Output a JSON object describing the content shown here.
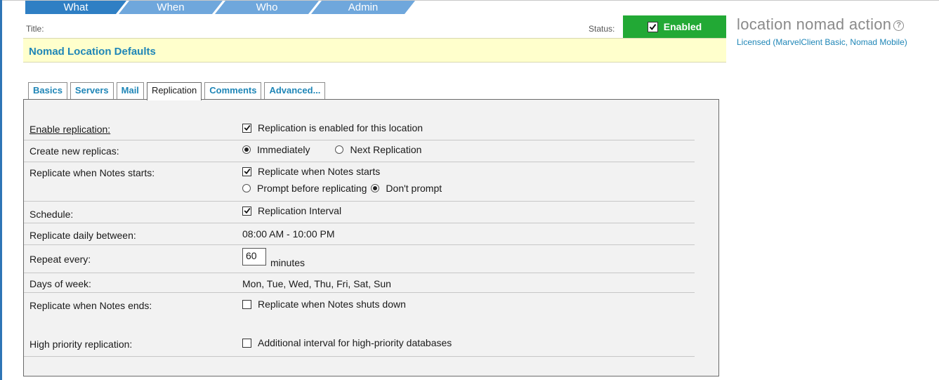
{
  "nav": {
    "tabs": [
      "What",
      "When",
      "Who",
      "Admin"
    ]
  },
  "header": {
    "title_label": "Title:",
    "title_value": "Nomad Location Defaults",
    "status_label": "Status:",
    "status_value": "Enabled"
  },
  "side": {
    "title": "location nomad action",
    "help_glyph": "?",
    "license": "Licensed (MarvelClient Basic, Nomad Mobile)"
  },
  "tabs": {
    "basics": "Basics",
    "servers": "Servers",
    "mail": "Mail",
    "replication": "Replication",
    "comments": "Comments",
    "advanced": "Advanced..."
  },
  "replication": {
    "enable_label": "Enable replication:",
    "enable_option": "Replication is enabled for this location",
    "create_label": "Create new replicas:",
    "create_immediately": "Immediately",
    "create_next": "Next Replication",
    "starts_label": "Replicate when Notes starts:",
    "starts_option": "Replicate when Notes starts",
    "prompt_option": "Prompt before replicating",
    "dont_prompt_option": "Don't prompt",
    "schedule_label": "Schedule:",
    "schedule_option": "Replication Interval",
    "daily_label": "Replicate daily  between:",
    "daily_value": "08:00 AM - 10:00 PM",
    "repeat_label": "Repeat every:",
    "repeat_value": "60",
    "repeat_unit": "minutes",
    "days_label": "Days of week:",
    "days_value": "Mon, Tue, Wed, Thu, Fri, Sat, Sun",
    "ends_label": "Replicate when Notes ends:",
    "ends_option": "Replicate when Notes shuts down",
    "priority_label": "High priority replication:",
    "priority_option": "Additional interval for high-priority databases"
  },
  "colors": {
    "nav_blue": "#2f7fc4",
    "nav_light": "#6fa7dc",
    "status_green": "#22a935",
    "link_blue": "#1f86b7",
    "title_bg": "#ffffcc"
  }
}
